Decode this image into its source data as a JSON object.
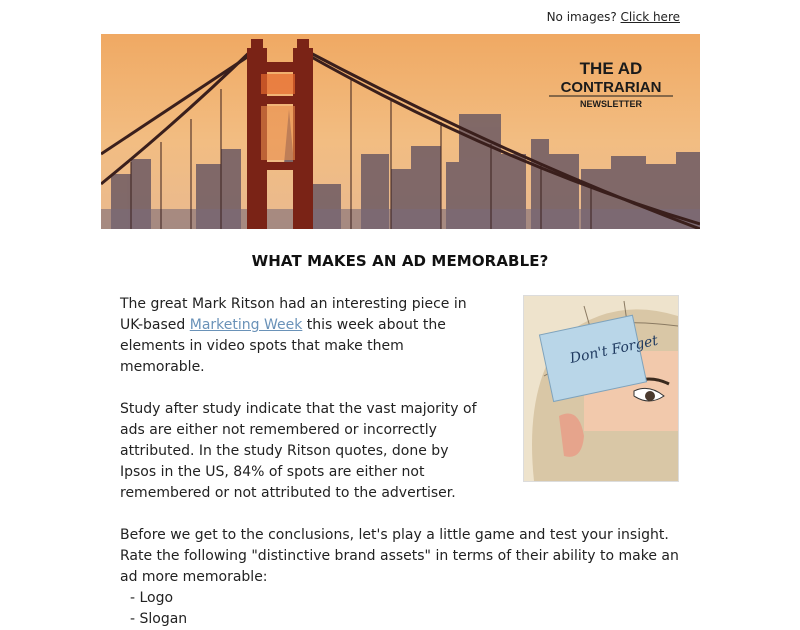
{
  "topbar": {
    "prefix": "No images?",
    "link_label": "Click here"
  },
  "banner": {
    "logo_line1": "THE AD",
    "logo_line2": "CONTRARIAN",
    "logo_line3": "NEWSLETTER"
  },
  "article": {
    "headline": "WHAT MAKES AN AD MEMORABLE?",
    "p1_before": "The great Mark Ritson had an interesting piece in UK-based ",
    "p1_link": "Marketing Week",
    "p1_after": " this week about the elements in video spots that make them memorable.",
    "p2": "Study after study indicate that the vast majority of ads are either not remembered or incorrectly attributed. In the study Ritson quotes, done by Ipsos in the US,  84% of spots are either not remembered or not attributed to the advertiser.",
    "p3": "Before we get to the conclusions, let's play a little game and test your insight. Rate the following \"distinctive brand assets\" in terms of their ability to make an ad more memorable:",
    "list": [
      "- Logo",
      "- Slogan"
    ]
  },
  "image_note": {
    "sticky_text": "Don't Forget"
  }
}
